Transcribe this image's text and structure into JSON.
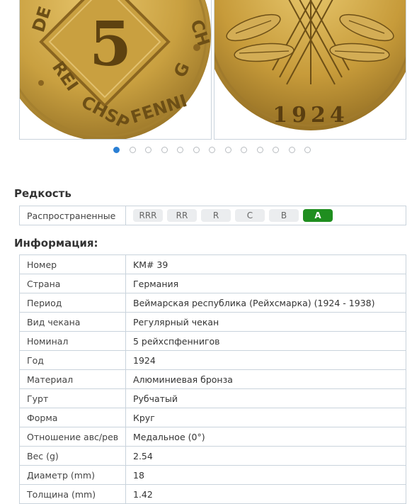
{
  "gallery": {
    "obverse": {
      "denomination": "5",
      "legend_top": "DEUTSCHES REICH",
      "legend_bottom": "REICHSPFENNIG"
    },
    "reverse": {
      "year": "1924"
    },
    "slide_count": 13,
    "active_slide": 0
  },
  "rarity": {
    "heading": "Редкость",
    "row_label": "Распространенные",
    "grades": [
      "RRR",
      "RR",
      "R",
      "C",
      "B",
      "A"
    ],
    "active_grade": "A",
    "colors": {
      "active": "#1f8e1f",
      "inactive": "#ebedef"
    }
  },
  "info": {
    "heading": "Информация:",
    "rows": [
      {
        "key": "Номер",
        "value": "KM# 39"
      },
      {
        "key": "Страна",
        "value": "Германия"
      },
      {
        "key": "Период",
        "value": "Веймарская республика (Рейхсмарка) (1924 - 1938)"
      },
      {
        "key": "Вид чекана",
        "value": "Регулярный чекан"
      },
      {
        "key": "Номинал",
        "value": "5 рейхспфеннигов"
      },
      {
        "key": "Год",
        "value": "1924"
      },
      {
        "key": "Материал",
        "value": "Алюминиевая бронза"
      },
      {
        "key": "Гурт",
        "value": "Рубчатый"
      },
      {
        "key": "Форма",
        "value": "Круг"
      },
      {
        "key": "Отношение авс/рев",
        "value": "Медальное (0°)"
      },
      {
        "key": "Вес (g)",
        "value": "2.54"
      },
      {
        "key": "Диаметр (mm)",
        "value": "18"
      },
      {
        "key": "Толщина (mm)",
        "value": "1.42"
      }
    ]
  }
}
